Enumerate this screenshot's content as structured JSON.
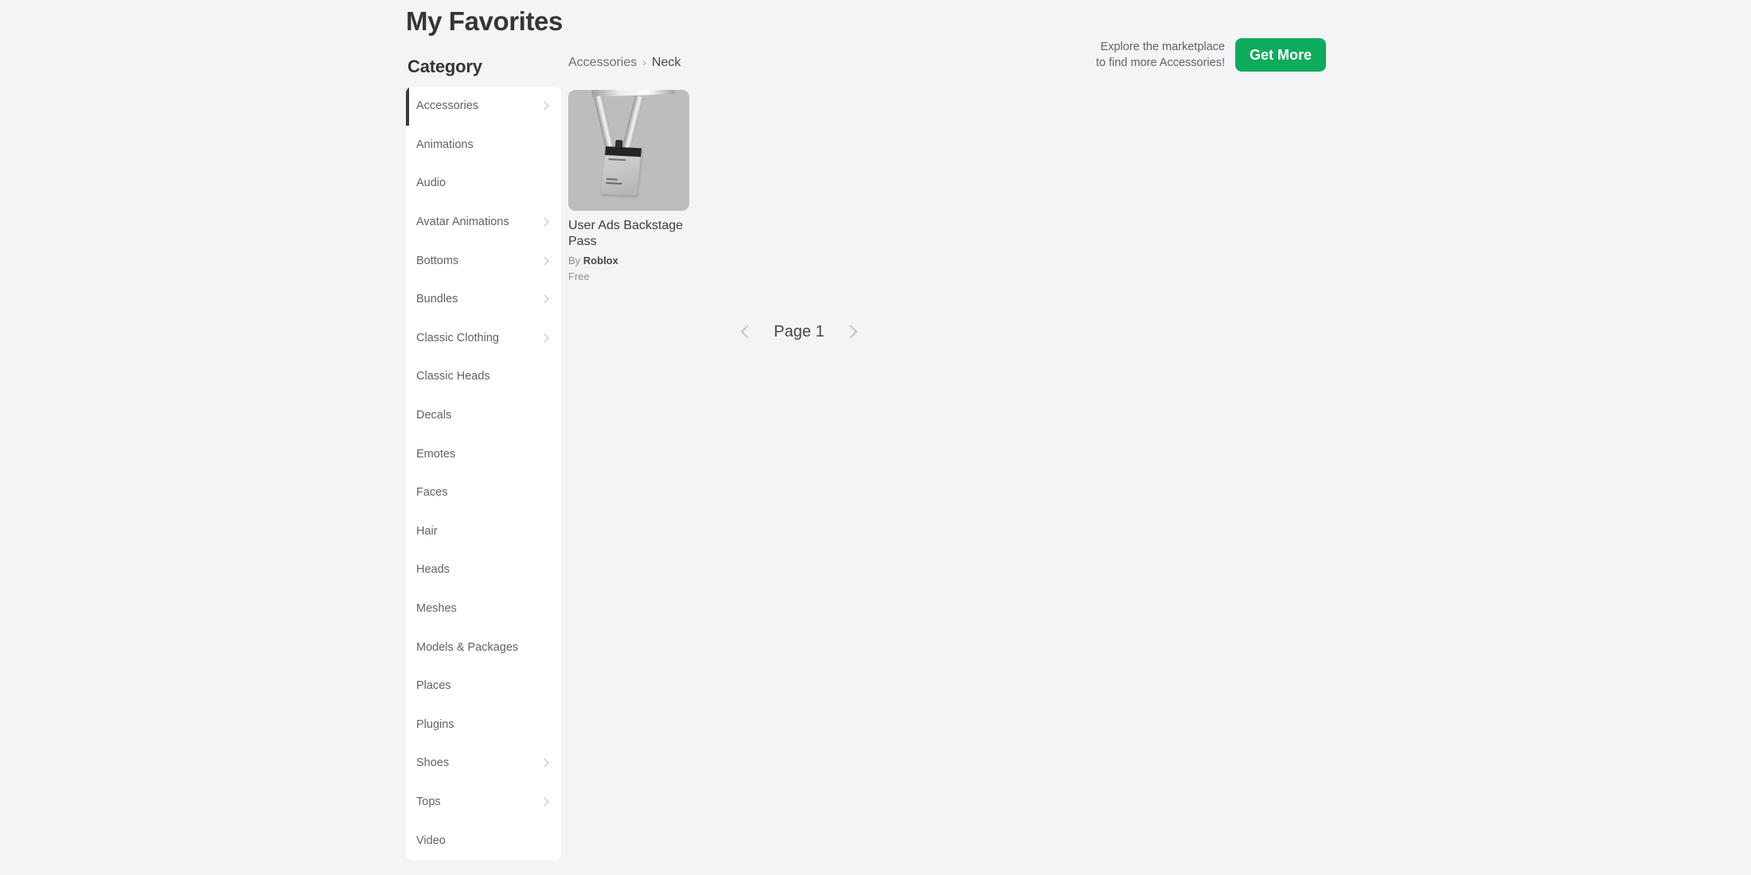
{
  "header": {
    "title": "My Favorites"
  },
  "sidebar": {
    "heading": "Category",
    "items": [
      {
        "label": "Accessories",
        "has_chevron": true,
        "selected": true
      },
      {
        "label": "Animations",
        "has_chevron": false,
        "selected": false
      },
      {
        "label": "Audio",
        "has_chevron": false,
        "selected": false
      },
      {
        "label": "Avatar Animations",
        "has_chevron": true,
        "selected": false
      },
      {
        "label": "Bottoms",
        "has_chevron": true,
        "selected": false
      },
      {
        "label": "Bundles",
        "has_chevron": true,
        "selected": false
      },
      {
        "label": "Classic Clothing",
        "has_chevron": true,
        "selected": false
      },
      {
        "label": "Classic Heads",
        "has_chevron": false,
        "selected": false
      },
      {
        "label": "Decals",
        "has_chevron": false,
        "selected": false
      },
      {
        "label": "Emotes",
        "has_chevron": false,
        "selected": false
      },
      {
        "label": "Faces",
        "has_chevron": false,
        "selected": false
      },
      {
        "label": "Hair",
        "has_chevron": false,
        "selected": false
      },
      {
        "label": "Heads",
        "has_chevron": false,
        "selected": false
      },
      {
        "label": "Meshes",
        "has_chevron": false,
        "selected": false
      },
      {
        "label": "Models & Packages",
        "has_chevron": false,
        "selected": false
      },
      {
        "label": "Places",
        "has_chevron": false,
        "selected": false
      },
      {
        "label": "Plugins",
        "has_chevron": false,
        "selected": false
      },
      {
        "label": "Shoes",
        "has_chevron": true,
        "selected": false
      },
      {
        "label": "Tops",
        "has_chevron": true,
        "selected": false
      },
      {
        "label": "Video",
        "has_chevron": false,
        "selected": false
      }
    ]
  },
  "breadcrumb": {
    "items": [
      "Accessories",
      "Neck"
    ],
    "separator": "›"
  },
  "promo": {
    "line1": "Explore the marketplace",
    "line2": "to find more Accessories!",
    "button_label": "Get More",
    "button_color": "#0eab5d"
  },
  "items": [
    {
      "title": "User Ads Backstage Pass",
      "creator_prefix": "By",
      "creator": "Roblox",
      "price": "Free",
      "thumbnail": "lanyard-backstage-pass-image"
    }
  ],
  "pagination": {
    "prev_icon": "chevron-left-icon",
    "next_icon": "chevron-right-icon",
    "page_label": "Page 1"
  },
  "colors": {
    "page_background": "#f2f4f5",
    "card_background": "#ffffff",
    "text_primary": "#393b3d",
    "text_muted": "#8b8f93",
    "accent_green": "#0eab5d",
    "selection_bar": "#393b3d"
  }
}
